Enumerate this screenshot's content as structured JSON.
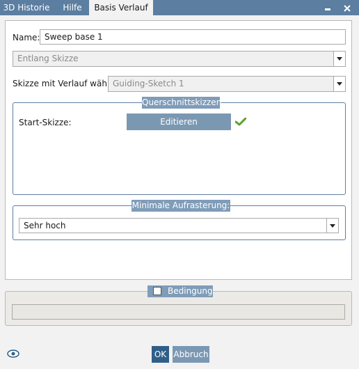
{
  "tabs": [
    {
      "label": "3D Historie"
    },
    {
      "label": "Hilfe"
    },
    {
      "label": "Basis Verlauf"
    }
  ],
  "window_buttons": {
    "minimize": "▬",
    "close": "✖"
  },
  "form": {
    "name_label": "Name:",
    "name_value": "Sweep base 1",
    "mode_value": "Entlang Skizze",
    "sketch_label": "Skizze mit Verlauf wählen:",
    "sketch_value": "Guiding-Sketch 1"
  },
  "cross_sections": {
    "legend": "Querschnittskizzen",
    "start_label": "Start-Skizze:",
    "edit_button": "Editieren"
  },
  "rasterization": {
    "legend": "Minimale Aufrasterung:",
    "value": "Sehr hoch"
  },
  "condition": {
    "legend": "Bedingung"
  },
  "footer": {
    "ok_label": "OK",
    "cancel_label": "Abbruch"
  },
  "colors": {
    "titlebar": "#5b7ea1",
    "legend": "#7f9cb8",
    "button": "#7b98b3",
    "ok_button": "#2f5f88",
    "check": "#5aa02c"
  },
  "icons": {
    "check": "check-icon",
    "visibility": "eye-icon"
  }
}
